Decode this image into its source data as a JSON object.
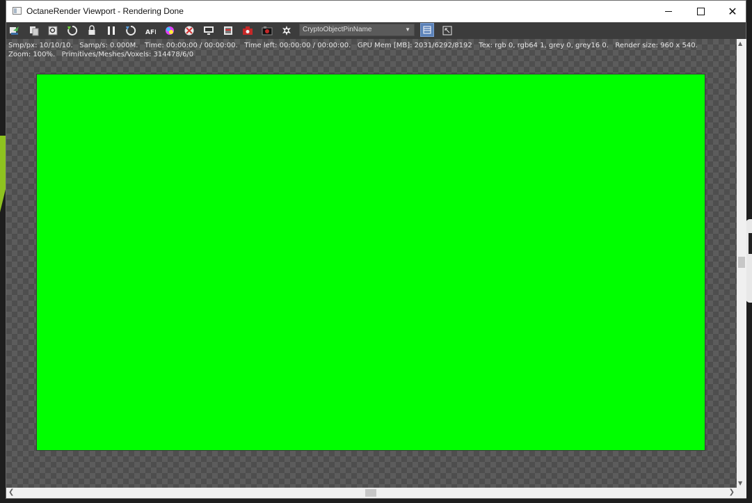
{
  "window": {
    "title": "OctaneRender Viewport - Rendering Done",
    "controls": {
      "minimize": "",
      "maximize": "",
      "close": "✕"
    }
  },
  "toolbar": {
    "icons": [
      "send-scene-icon",
      "load-scene-icon",
      "zoom-icon",
      "restart-render-icon",
      "lock-icon",
      "pause-icon",
      "reset-icon",
      "afi-icon",
      "color-picker-icon",
      "region-render-icon",
      "monitor-icon",
      "film-strip-icon",
      "camera-icon",
      "save-image-icon",
      "settings-gear-icon"
    ],
    "crypto_select": {
      "value": "CryptoObjectPinName",
      "arrow": "▼"
    },
    "toggle_buttons": [
      "render-passes-icon",
      "fit-view-icon"
    ]
  },
  "stats": {
    "line1": "Smp/px: 10/10/10.   Samp/s: 0.000M.   Time: 00:00:00 / 00:00:00.   Time left: 00:00:00 / 00:00:00.   GPU Mem [MB]: 2031/6292/8192   Tex: rgb 0, rgb64 1, grey 0, grey16 0.   Render size: 960 x 540.",
    "line2": "Zoom: 100%.   Primitives/Meshes/Voxels: 314478/6/0"
  },
  "render": {
    "color": "#00ff00"
  },
  "scrollbars": {
    "up": "▲",
    "down": "▼",
    "left": "❮",
    "right": "❯"
  }
}
